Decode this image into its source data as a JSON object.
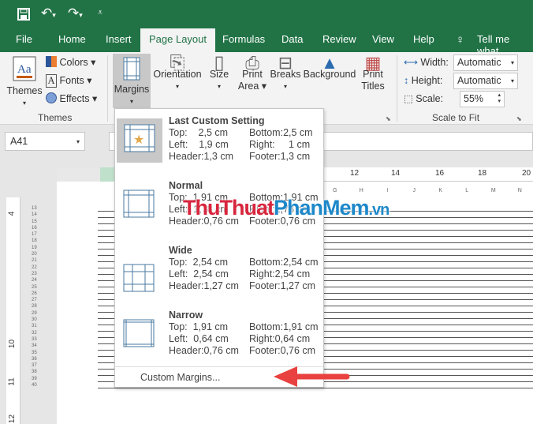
{
  "quick_access": {
    "save": "save-icon",
    "undo": "undo-icon",
    "redo": "redo-icon",
    "customize": "customize-icon"
  },
  "tabs": [
    "File",
    "Home",
    "Insert",
    "Page Layout",
    "Formulas",
    "Data",
    "Review",
    "View",
    "Help"
  ],
  "active_tab": "Page Layout",
  "tell_me": "Tell me what",
  "ribbon": {
    "themes": {
      "label": "Themes",
      "colors": "Colors",
      "fonts": "Fonts",
      "effects": "Effects",
      "group": "Themes"
    },
    "page_setup": {
      "margins": "Margins",
      "orientation": "Orientation",
      "size": "Size",
      "print_area_1": "Print",
      "print_area_2": "Area",
      "breaks": "Breaks",
      "background": "Background",
      "print_titles_1": "Print",
      "print_titles_2": "Titles"
    },
    "scale_to_fit": {
      "width_label": "Width:",
      "width_value": "Automatic",
      "height_label": "Height:",
      "height_value": "Automatic",
      "scale_label": "Scale:",
      "scale_value": "55%",
      "group": "Scale to Fit"
    }
  },
  "name_box": "A41",
  "ruler": [
    "12",
    "14",
    "16",
    "18",
    "20"
  ],
  "row_ruler": [
    "4",
    "10",
    "11",
    "12"
  ],
  "columns": [
    "G",
    "H",
    "I",
    "J",
    "K",
    "L",
    "M",
    "N"
  ],
  "rows": [
    "13",
    "14",
    "15",
    "16",
    "17",
    "18",
    "19",
    "20",
    "21",
    "22",
    "23",
    "24",
    "25",
    "26",
    "27",
    "28",
    "29",
    "30",
    "31",
    "32",
    "33",
    "34",
    "35",
    "36",
    "37",
    "38",
    "39",
    "40"
  ],
  "margins_menu": {
    "options": [
      {
        "title": "Last Custom Setting",
        "top": "Top:    2,5 cm",
        "bottom": "Bottom:2,5 cm",
        "left": "Left:    1,9 cm",
        "right": "Right:     1 cm",
        "header": "Header:1,3 cm",
        "footer": "Footer:1,3 cm"
      },
      {
        "title": "Normal",
        "top": "Top:  1,91 cm",
        "bottom": "Bottom:1,91 cm",
        "left": "Left:  1,78 cm",
        "right": "Right:1,78 cm",
        "header": "Header:0,76 cm",
        "footer": "Footer:0,76 cm"
      },
      {
        "title": "Wide",
        "top": "Top:  2,54 cm",
        "bottom": "Bottom:2,54 cm",
        "left": "Left:  2,54 cm",
        "right": "Right:2,54 cm",
        "header": "Header:1,27 cm",
        "footer": "Footer:1,27 cm"
      },
      {
        "title": "Narrow",
        "top": "Top:  1,91 cm",
        "bottom": "Bottom:1,91 cm",
        "left": "Left:  0,64 cm",
        "right": "Right:0,64 cm",
        "header": "Header:0,76 cm",
        "footer": "Footer:0,76 cm"
      }
    ],
    "custom": "Custom Margins..."
  },
  "watermark": {
    "part1": "ThuThuat",
    "part2": "PhanMem",
    "part3": ".vn"
  },
  "colors": {
    "excel_green": "#217346",
    "arrow": "#e8413f",
    "watermark_red": "#d7263d",
    "watermark_blue": "#1e88c9"
  }
}
